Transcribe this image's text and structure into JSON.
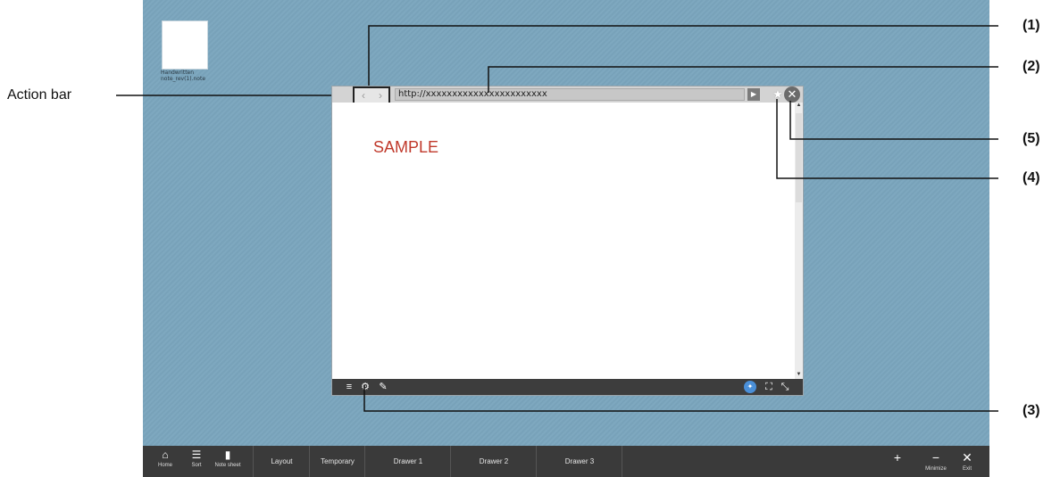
{
  "desktop": {
    "note": {
      "name_line1": "Handwritten",
      "name_line2": "note_rev(1).note"
    }
  },
  "labels": {
    "action_bar": "Action bar",
    "callout_1": "(1)",
    "callout_2": "(2)",
    "callout_3": "(3)",
    "callout_4": "(4)",
    "callout_5": "(5)"
  },
  "window": {
    "url": "http://xxxxxxxxxxxxxxxxxxxxxxx",
    "back_icon": "chevron-left-icon",
    "forward_icon": "chevron-right-icon",
    "go_icon": "play-icon",
    "favorite_icon": "star-icon",
    "close_icon": "close-icon",
    "content_text": "SAMPLE",
    "bottom_icons": [
      "menu-icon",
      "settings-icon",
      "pen-icon",
      "pin-icon",
      "fullscreen-icon",
      "resize-icon"
    ]
  },
  "taskbar": {
    "home": "Home",
    "sort": "Sort",
    "note_sheet": "Note sheet",
    "layout": "Layout",
    "temporary": "Temporary",
    "drawer1": "Drawer 1",
    "drawer2": "Drawer 2",
    "drawer3": "Drawer 3",
    "add": "+",
    "minimize": "Minimize",
    "exit": "Exit"
  },
  "colors": {
    "desktop_bg": "#7aa5bd",
    "taskbar_bg": "#3a3a3a",
    "sample_text": "#c0392b",
    "pin_accent": "#4a8fd8"
  }
}
